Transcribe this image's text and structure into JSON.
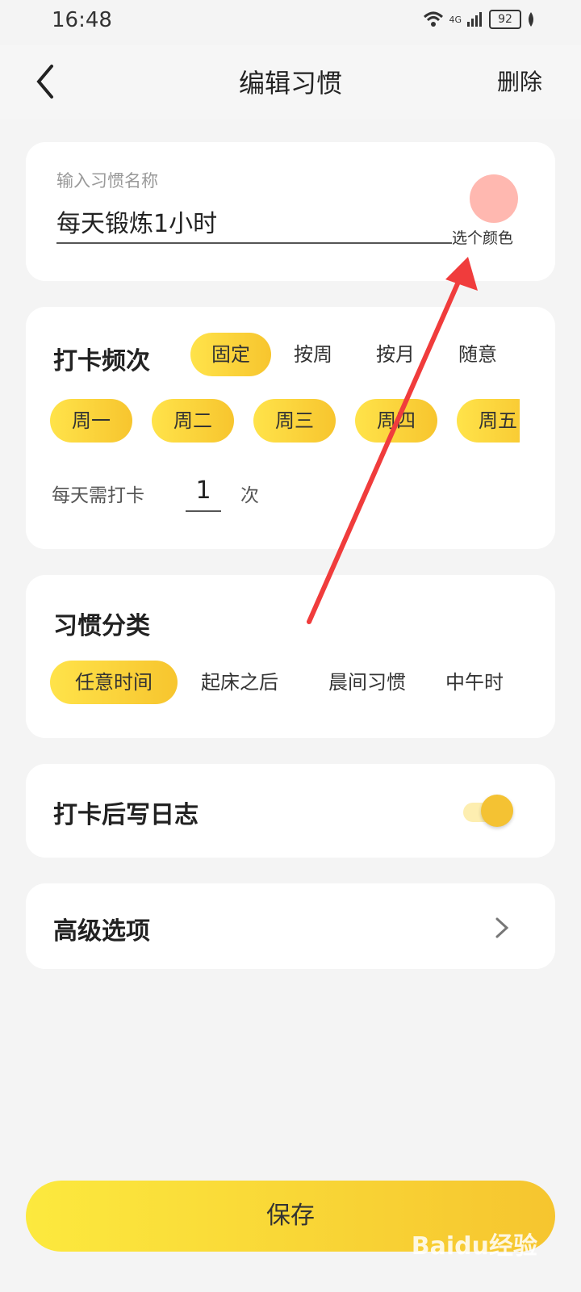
{
  "status_bar": {
    "time": "16:48",
    "network": "4G",
    "battery": "92"
  },
  "header": {
    "title": "编辑习惯",
    "delete_label": "删除"
  },
  "name_card": {
    "placeholder": "输入习惯名称",
    "value": "每天锻炼1小时",
    "color_label": "选个颜色",
    "color": "#ffb8b0"
  },
  "frequency": {
    "title": "打卡频次",
    "modes": [
      "固定",
      "按周",
      "按月",
      "随意"
    ],
    "days": [
      "周一",
      "周二",
      "周三",
      "周四",
      "周五"
    ],
    "per_day_label": "每天需打卡",
    "per_day_value": "1",
    "unit": "次"
  },
  "category": {
    "title": "习惯分类",
    "items": [
      "任意时间",
      "起床之后",
      "晨间习惯",
      "中午时"
    ]
  },
  "journal": {
    "label": "打卡后写日志"
  },
  "advanced": {
    "label": "高级选项"
  },
  "save_label": "保存",
  "watermark": "Baidu经验",
  "colors": {
    "accent": "#f7c52e",
    "annotation_arrow": "#f03c3c"
  }
}
